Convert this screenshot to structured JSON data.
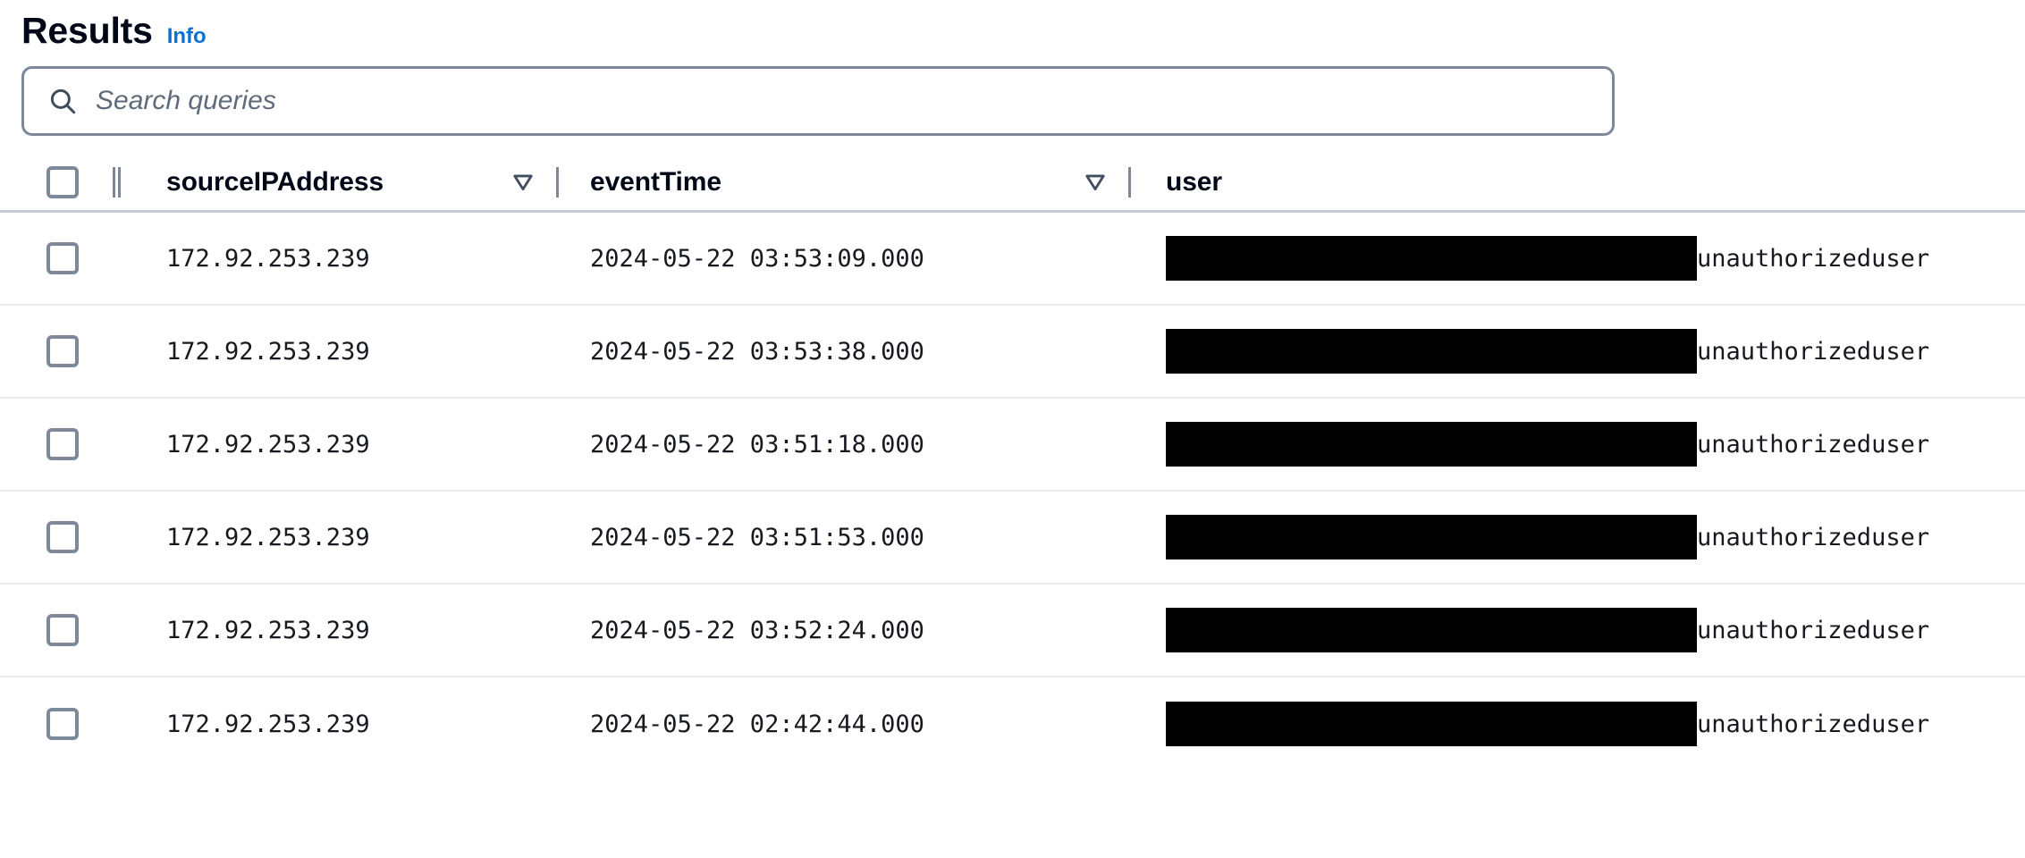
{
  "header": {
    "title": "Results",
    "info_label": "Info"
  },
  "search": {
    "placeholder": "Search queries",
    "value": "",
    "icon": "search-icon"
  },
  "table": {
    "select_all_checkbox": false,
    "columns": [
      {
        "id": "sourceIPAddress",
        "label": "sourceIPAddress",
        "sortable": true,
        "sort_icon": "sort-descending-icon"
      },
      {
        "id": "eventTime",
        "label": "eventTime",
        "sortable": true,
        "sort_icon": "sort-descending-icon"
      },
      {
        "id": "user",
        "label": "user",
        "sortable": false,
        "sort_icon": ""
      }
    ],
    "rows": [
      {
        "checked": false,
        "sourceIPAddress": "172.92.253.239",
        "eventTime": "2024-05-22 03:53:09.000",
        "user_redacted": true,
        "user": "unauthorizeduser"
      },
      {
        "checked": false,
        "sourceIPAddress": "172.92.253.239",
        "eventTime": "2024-05-22 03:53:38.000",
        "user_redacted": true,
        "user": "unauthorizeduser"
      },
      {
        "checked": false,
        "sourceIPAddress": "172.92.253.239",
        "eventTime": "2024-05-22 03:51:18.000",
        "user_redacted": true,
        "user": "unauthorizeduser"
      },
      {
        "checked": false,
        "sourceIPAddress": "172.92.253.239",
        "eventTime": "2024-05-22 03:51:53.000",
        "user_redacted": true,
        "user": "unauthorizeduser"
      },
      {
        "checked": false,
        "sourceIPAddress": "172.92.253.239",
        "eventTime": "2024-05-22 03:52:24.000",
        "user_redacted": true,
        "user": "unauthorizeduser"
      },
      {
        "checked": false,
        "sourceIPAddress": "172.92.253.239",
        "eventTime": "2024-05-22 02:42:44.000",
        "user_redacted": true,
        "user": "unauthorizeduser"
      }
    ]
  },
  "colors": {
    "link": "#0972d3",
    "title": "#000716",
    "border": "#7d8998",
    "row_divider": "#e9ebed",
    "header_divider": "#c6cbd4",
    "redaction": "#000000",
    "text": "#16191f",
    "placeholder": "#5f6b7a"
  }
}
